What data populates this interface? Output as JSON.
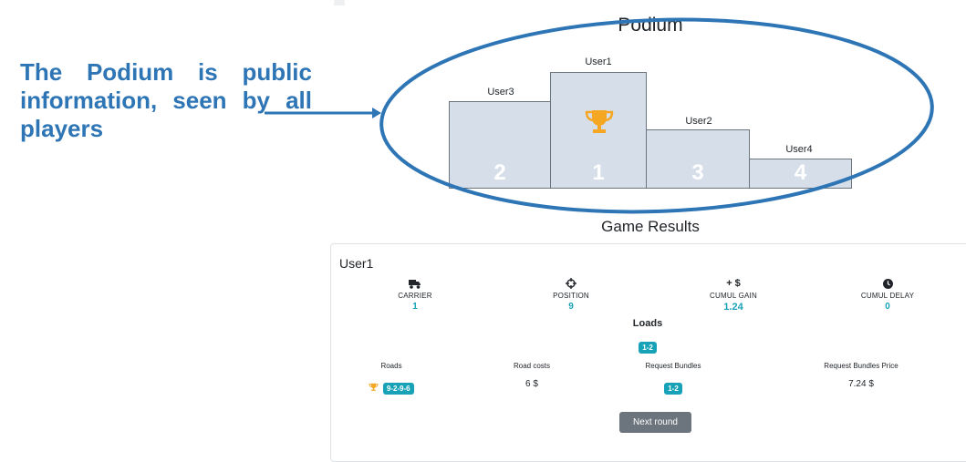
{
  "annotation": {
    "text": "The Podium is public information, seen by all players"
  },
  "podium": {
    "title": "Podium",
    "steps": [
      {
        "name": "User3",
        "rank": "2"
      },
      {
        "name": "User1",
        "rank": "1"
      },
      {
        "name": "User2",
        "rank": "3"
      },
      {
        "name": "User4",
        "rank": "4"
      }
    ],
    "winner_icon": "trophy-icon"
  },
  "results": {
    "title": "Game Results",
    "user": "User1",
    "stats": [
      {
        "icon": "truck-icon",
        "label": "CARRIER",
        "value": "1"
      },
      {
        "icon": "crosshair-icon",
        "label": "POSITION",
        "value": "9"
      },
      {
        "icon": "+ $",
        "label": "CUMUL GAIN",
        "value": "1.24"
      },
      {
        "icon": "clock-icon",
        "label": "CUMUL DELAY",
        "value": "0"
      }
    ],
    "loads": {
      "title": "Loads",
      "badge": "1-2",
      "columns": {
        "roads": {
          "label": "Roads",
          "badge": "9-2-9-6",
          "icon": "trophy-icon"
        },
        "road_costs": {
          "label": "Road costs",
          "value": "6 $"
        },
        "request_bundles": {
          "label": "Request Bundles",
          "badge": "1-2"
        },
        "request_bundles_price": {
          "label": "Request Bundles Price",
          "value": "7.24 $"
        }
      }
    },
    "next_button": "Next round"
  },
  "colors": {
    "annotation": "#2e75b6",
    "accent": "#17a2b8",
    "podium_fill": "#d6dfe9",
    "trophy": "#f5a623",
    "button": "#6c757d"
  }
}
